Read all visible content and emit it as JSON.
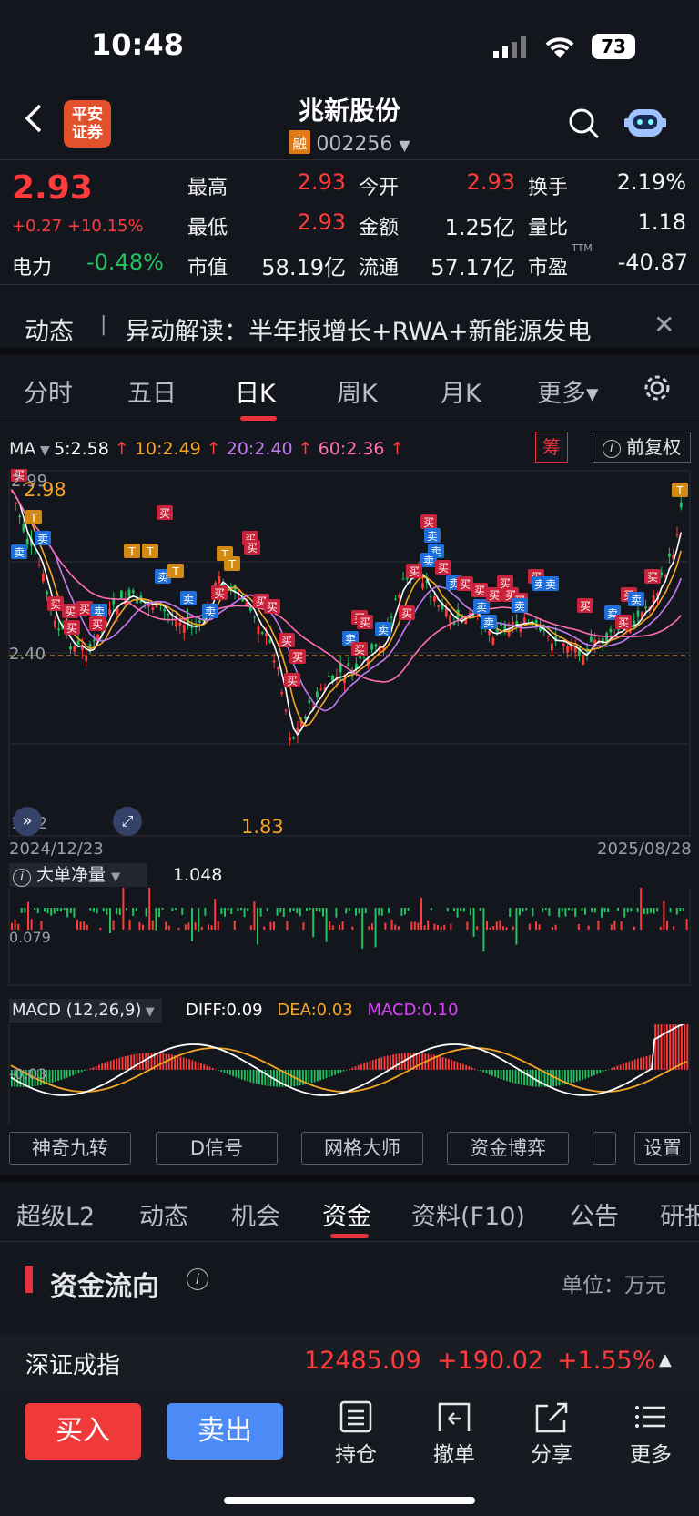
{
  "status": {
    "time": "10:48",
    "battery": "73"
  },
  "header": {
    "title": "兆新股份",
    "margin_badge": "融",
    "code": "002256",
    "broker_logo": "平安\n证券"
  },
  "quote": {
    "price": "2.93",
    "change": "+0.27 +10.15%",
    "power_label": "电力",
    "power_value": "-0.48%",
    "high_label": "最高",
    "high": "2.93",
    "low_label": "最低",
    "low": "2.93",
    "cap_label": "市值",
    "cap": "58.19亿",
    "open_label": "今开",
    "open": "2.93",
    "amount_label": "金额",
    "amount": "1.25亿",
    "float_label": "流通",
    "float": "57.17亿",
    "turnover_label": "换手",
    "turnover": "2.19%",
    "vol_ratio_label": "量比",
    "vol_ratio": "1.18",
    "pe_label": "市盈",
    "pe_sup": "TTM",
    "pe": "-40.87"
  },
  "news": {
    "label": "动态",
    "text": "异动解读：半年报增长+RWA+新能源发电"
  },
  "chart_tabs": [
    "分时",
    "五日",
    "日K",
    "周K",
    "月K",
    "更多▾"
  ],
  "ma": {
    "label": "MA",
    "ma5": "5:2.58",
    "ma10": "10:2.49",
    "ma20": "20:2.40",
    "ma60": "60:2.36",
    "chip": "筹",
    "adjust": "前复权"
  },
  "kline": {
    "high_mark": "2.98",
    "low_mark": "1.83",
    "ref_price": "2.40",
    "top_tick": "2.99",
    "bottom_tick": "1.82",
    "start_date": "2024/12/23",
    "end_date": "2025/08/28",
    "marker_buy": "买",
    "marker_sell": "卖",
    "marker_t": "T"
  },
  "bigorder": {
    "label": "大单净量",
    "value": "1.048",
    "axis": "0.079"
  },
  "macd": {
    "label": "MACD (12,26,9)",
    "diff": "DIFF:0.09",
    "dea": "DEA:0.03",
    "macd": "MACD:0.10",
    "axis": "-0.03"
  },
  "indicator_buttons": [
    "神奇九转",
    "D信号",
    "网格大师",
    "资金博弈"
  ],
  "settings_label": "设置",
  "section_tabs": [
    "超级L2",
    "动态",
    "机会",
    "资金",
    "资料(F10)",
    "公告",
    "研报"
  ],
  "fund_flow": {
    "title": "资金流向",
    "unit": "单位：万元"
  },
  "index_ticker": {
    "name": "深证成指",
    "value": "12485.09",
    "change": "+190.02",
    "pct": "+1.55%"
  },
  "bottom": {
    "buy": "买入",
    "sell": "卖出",
    "hold": "持仓",
    "cancel": "撤单",
    "share": "分享",
    "more": "更多"
  },
  "colors": {
    "up": "#ff3b3b",
    "down": "#22c25f",
    "ma5": "#ffffff",
    "ma10": "#f5a623",
    "ma20": "#c07cf0",
    "ma60": "#ff6fb5",
    "accent": "#e8323c"
  }
}
